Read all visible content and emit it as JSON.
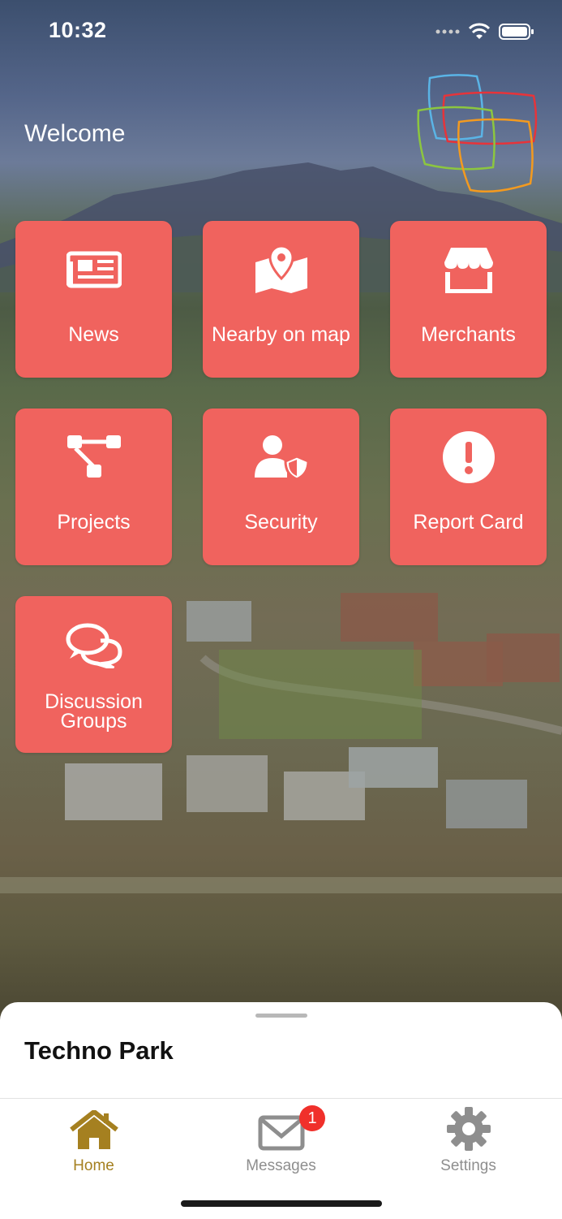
{
  "status_bar": {
    "time": "10:32"
  },
  "header": {
    "welcome": "Welcome"
  },
  "tiles": [
    {
      "label": "News",
      "icon": "newspaper-icon"
    },
    {
      "label": "Nearby on map",
      "icon": "map-pin-icon"
    },
    {
      "label": "Merchants",
      "icon": "store-icon"
    },
    {
      "label": "Projects",
      "icon": "project-tree-icon"
    },
    {
      "label": "Security",
      "icon": "user-shield-icon"
    },
    {
      "label": "Report Card",
      "icon": "exclamation-circle-icon"
    },
    {
      "label_line1": "Discussion",
      "label_line2": "Groups",
      "icon": "chat-bubbles-icon"
    }
  ],
  "sheet": {
    "title": "Techno Park"
  },
  "tabbar": {
    "items": [
      {
        "label": "Home",
        "icon": "home-icon",
        "active": true
      },
      {
        "label": "Messages",
        "icon": "envelope-icon",
        "badge": "1"
      },
      {
        "label": "Settings",
        "icon": "gear-icon"
      }
    ]
  },
  "colors": {
    "tile": "#f0635e",
    "active_tab": "#a58020",
    "inactive_tab": "#8e8e8e",
    "badge": "#f0302b"
  }
}
